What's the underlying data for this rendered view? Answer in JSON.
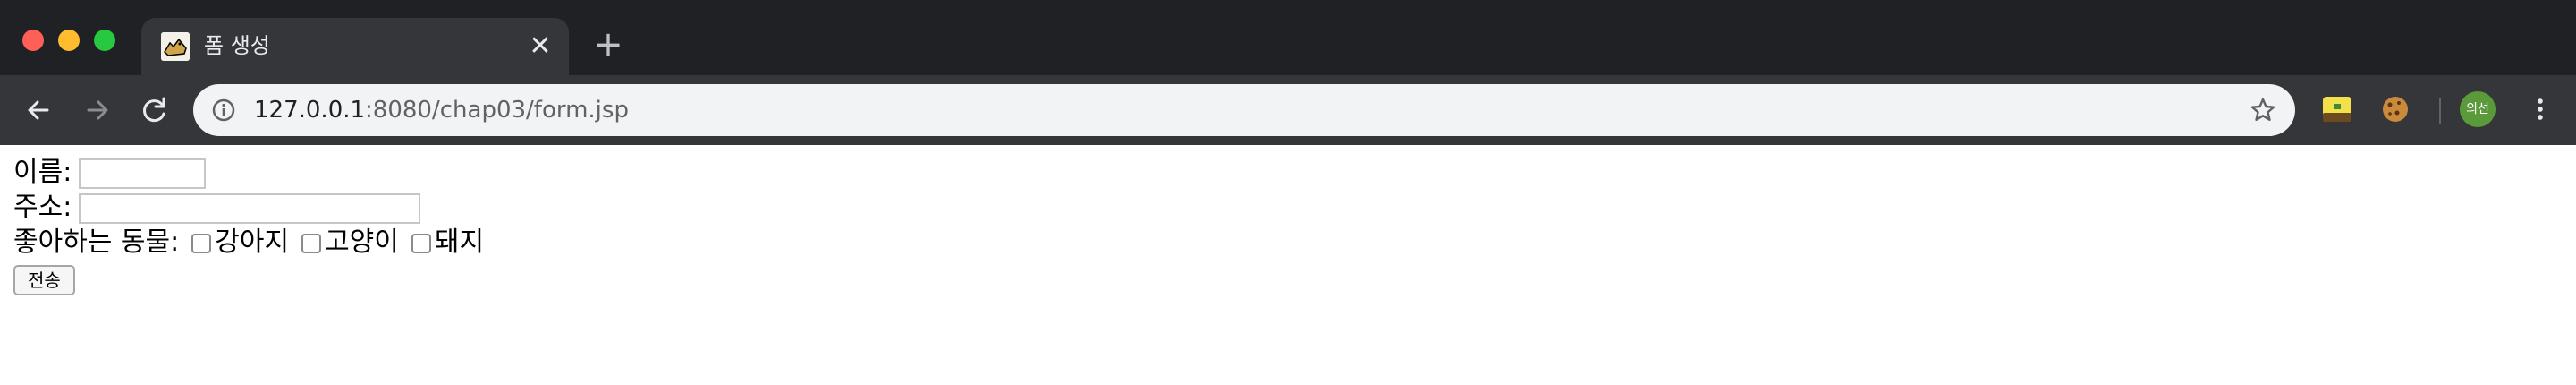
{
  "browser": {
    "tab": {
      "title": "폼 생성",
      "close_glyph": "✕"
    },
    "new_tab_glyph": "+",
    "address": {
      "host": "127.0.0.1",
      "rest": ":8080/chap03/form.jsp"
    },
    "profile": {
      "label": "의선"
    }
  },
  "form": {
    "name_label": "이름:",
    "address_label": "주소:",
    "animals_label": "좋아하는 동물:",
    "animals": [
      {
        "label": "강아지",
        "checked": false
      },
      {
        "label": "고양이",
        "checked": false
      },
      {
        "label": "돼지",
        "checked": false
      }
    ],
    "submit_label": "전송"
  },
  "colors": {
    "titlebar": "#202124",
    "tab": "#35363a",
    "omnibox": "#f1f3f4",
    "avatar": "#5a9a3a"
  },
  "icons": {
    "tab_favicon": "tomcat-favicon",
    "back": "arrow-left-icon",
    "forward": "arrow-right-icon",
    "reload": "reload-icon",
    "site_info": "info-icon",
    "bookmark": "star-icon",
    "extension_1": "extension-icon",
    "extension_2": "cookie-icon",
    "menu": "kebab-menu-icon"
  }
}
